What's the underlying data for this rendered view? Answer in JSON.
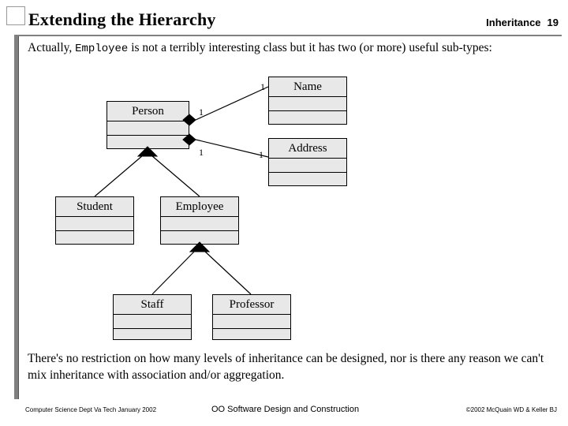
{
  "header": {
    "title": "Extending the Hierarchy",
    "topic": "Inheritance",
    "page": "19"
  },
  "body": {
    "intro_before": "Actually, ",
    "intro_code": "Employee",
    "intro_after": " is not a terribly interesting class but it has two (or more) useful sub-types:",
    "closing": "There's no restriction on how many levels of inheritance can be designed, nor is there any reason we can't mix inheritance with association and/or aggregation."
  },
  "diagram": {
    "classes": [
      {
        "id": "person",
        "label": "Person"
      },
      {
        "id": "name",
        "label": "Name"
      },
      {
        "id": "address",
        "label": "Address"
      },
      {
        "id": "student",
        "label": "Student"
      },
      {
        "id": "employee",
        "label": "Employee"
      },
      {
        "id": "staff",
        "label": "Staff"
      },
      {
        "id": "professor",
        "label": "Professor"
      }
    ],
    "multiplicities": [
      {
        "id": "name-end",
        "value": "1"
      },
      {
        "id": "person-name-end",
        "value": "1"
      },
      {
        "id": "person-address-end",
        "value": "1"
      },
      {
        "id": "address-end",
        "value": "1"
      }
    ]
  },
  "footer": {
    "left": "Computer Science Dept Va Tech January 2002",
    "center": "OO Software Design and Construction",
    "right": "©2002 McQuain WD & Keller BJ"
  }
}
